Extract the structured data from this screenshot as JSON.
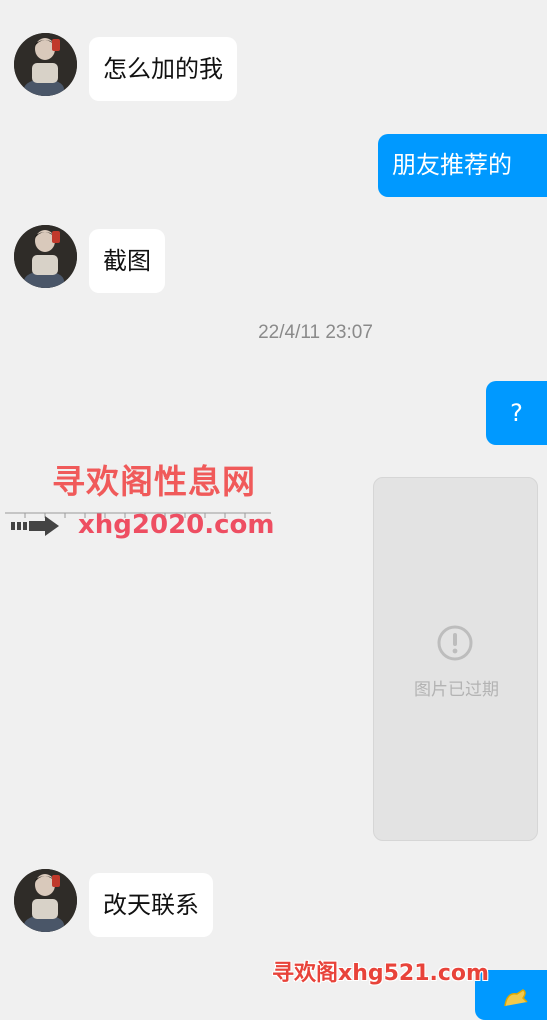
{
  "messages": [
    {
      "side": "in",
      "text": "怎么加的我"
    },
    {
      "side": "out",
      "text": "朋友推荐的"
    },
    {
      "side": "in",
      "text": "截图"
    },
    {
      "side": "out",
      "text": "?"
    },
    {
      "side": "in",
      "text": "改天联系"
    }
  ],
  "timestamp": "22/4/11 23:07",
  "expired_image": {
    "label": "图片已过期",
    "icon": "exclamation-circle-icon"
  },
  "watermark": {
    "title": "寻欢阁性息网",
    "url": "xhg2020.com",
    "bottom": "寻欢阁xhg521.com"
  },
  "colors": {
    "outgoing": "#0099ff",
    "incoming": "#ffffff",
    "background": "#f0f0f0"
  }
}
